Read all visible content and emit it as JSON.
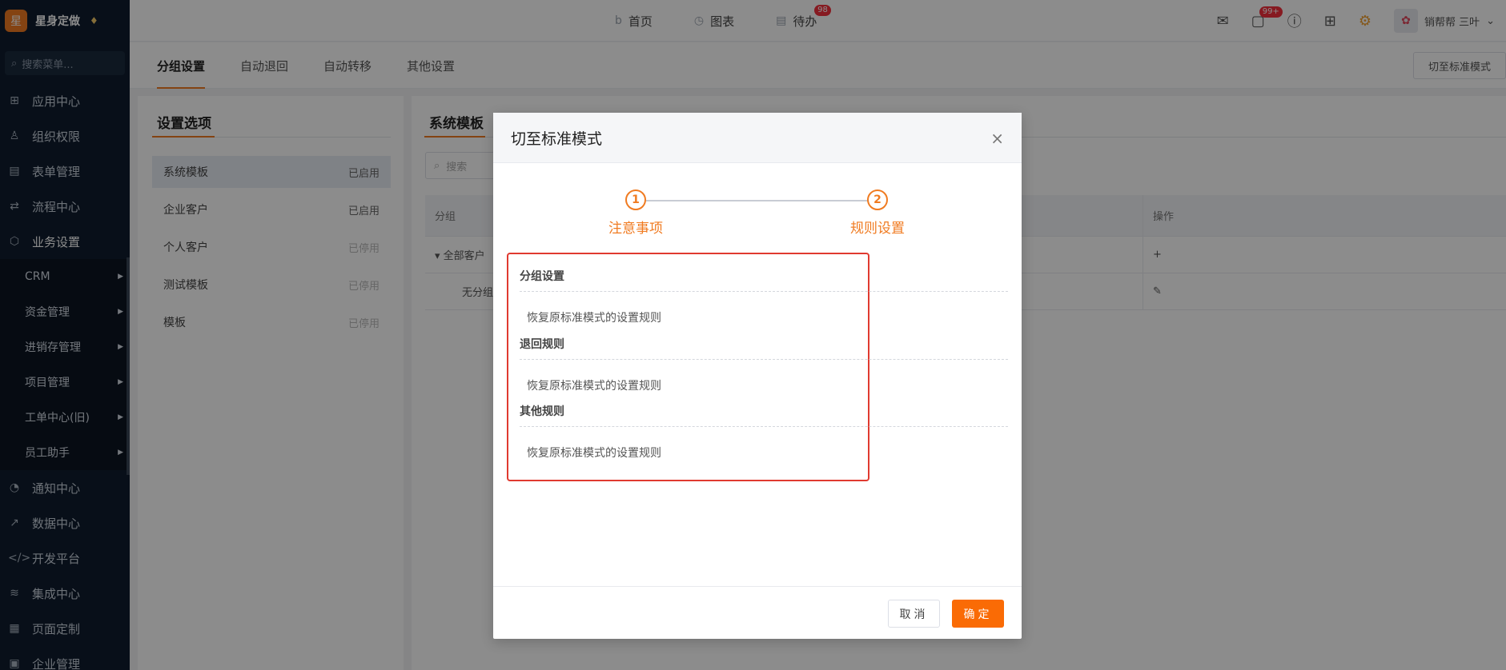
{
  "brand": {
    "logo_text": "星",
    "name": "星身定做",
    "gem": "♦"
  },
  "search": {
    "placeholder": "搜索菜单..."
  },
  "nav": {
    "top_items": [
      {
        "icon": "apps-icon",
        "glyph": "⊞",
        "label": "应用中心"
      },
      {
        "icon": "user-icon",
        "glyph": "♙",
        "label": "组织权限"
      },
      {
        "icon": "form-icon",
        "glyph": "▤",
        "label": "表单管理"
      },
      {
        "icon": "flow-icon",
        "glyph": "⇄",
        "label": "流程中心"
      },
      {
        "icon": "cube-icon",
        "glyph": "⬡",
        "label": "业务设置"
      }
    ],
    "sub_items": [
      {
        "label": "CRM"
      },
      {
        "label": "资金管理"
      },
      {
        "label": "进销存管理"
      },
      {
        "label": "项目管理"
      },
      {
        "label": "工单中心(旧)"
      },
      {
        "label": "员工助手"
      }
    ],
    "bottom_items": [
      {
        "icon": "bell-icon",
        "glyph": "◔",
        "label": "通知中心"
      },
      {
        "icon": "chart-line-icon",
        "glyph": "↗",
        "label": "数据中心"
      },
      {
        "icon": "code-icon",
        "glyph": "</>",
        "label": "开发平台"
      },
      {
        "icon": "layers-icon",
        "glyph": "≋",
        "label": "集成中心"
      },
      {
        "icon": "layout-icon",
        "glyph": "▦",
        "label": "页面定制"
      },
      {
        "icon": "company-icon",
        "glyph": "▣",
        "label": "企业管理"
      }
    ]
  },
  "topbar": {
    "nav": [
      {
        "icon": "home-icon",
        "glyph": "b",
        "label": "首页"
      },
      {
        "icon": "chart-icon",
        "glyph": "◷",
        "label": "图表"
      },
      {
        "icon": "todo-icon",
        "glyph": "▤",
        "label": "待办",
        "badge": "98"
      }
    ],
    "message_badge": "99+",
    "user_name": "销帮帮 三叶",
    "user_caret": "⌄"
  },
  "tabs": [
    "分组设置",
    "自动退回",
    "自动转移",
    "其他设置"
  ],
  "switch_button": "切至标准模式",
  "left_panel": {
    "title": "设置选项",
    "options": [
      {
        "label": "系统模板",
        "status": "已启用",
        "on": true
      },
      {
        "label": "企业客户",
        "status": "已启用",
        "on": true
      },
      {
        "label": "个人客户",
        "status": "已停用",
        "on": false
      },
      {
        "label": "测试模板",
        "status": "已停用",
        "on": false
      },
      {
        "label": "模板",
        "status": "已停用",
        "on": false
      }
    ]
  },
  "right_panel": {
    "title": "系统模板",
    "search_placeholder": "搜索",
    "columns": [
      "分组",
      "操作"
    ],
    "rows": [
      {
        "name": "全部客户",
        "action": "+"
      },
      {
        "name": "无分组",
        "action": "✎"
      }
    ]
  },
  "modal": {
    "title": "切至标准模式",
    "close": "×",
    "steps": [
      {
        "num": "1",
        "label": "注意事项"
      },
      {
        "num": "2",
        "label": "规则设置"
      }
    ],
    "rules": [
      {
        "title": "分组设置",
        "desc": "恢复原标准模式的设置规则"
      },
      {
        "title": "退回规则",
        "desc": "恢复原标准模式的设置规则"
      },
      {
        "title": "其他规则",
        "desc": "恢复原标准模式的设置规则"
      }
    ],
    "cancel": "取消",
    "ok": "确定"
  },
  "colors": {
    "accent": "#f07b21",
    "primary_button": "#fa6b05",
    "highlight_border": "#e03a30",
    "sidebar_bg": "#0f1d2e"
  }
}
